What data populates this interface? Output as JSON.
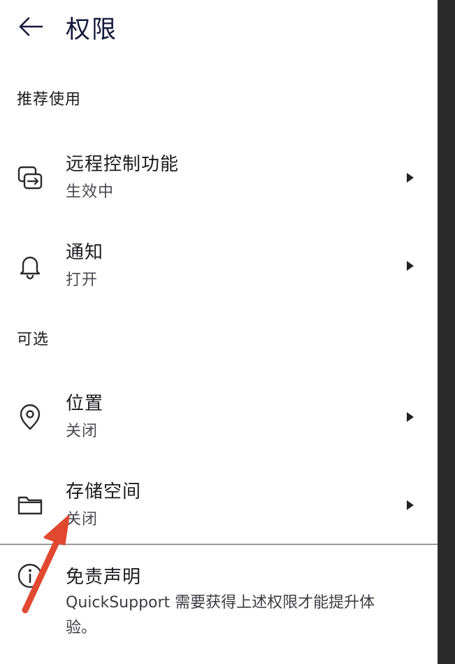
{
  "header": {
    "title": "权限"
  },
  "sections": {
    "recommended_label": "推荐使用",
    "optional_label": "可选"
  },
  "rows": [
    {
      "title": "远程控制功能",
      "status": "生效中"
    },
    {
      "title": "通知",
      "status": "打开"
    },
    {
      "title": "位置",
      "status": "关闭"
    },
    {
      "title": "存储空间",
      "status": "关闭"
    }
  ],
  "disclaimer": {
    "title": "免责声明",
    "body": "QuickSupport 需要获得上述权限才能提升体验。"
  },
  "colors": {
    "title": "#14183a",
    "annotation_arrow": "#e0492f"
  },
  "icons": [
    "back-arrow-icon",
    "remote-control-icon",
    "bell-icon",
    "location-pin-icon",
    "folder-icon",
    "info-icon",
    "chevron-right-icon"
  ]
}
